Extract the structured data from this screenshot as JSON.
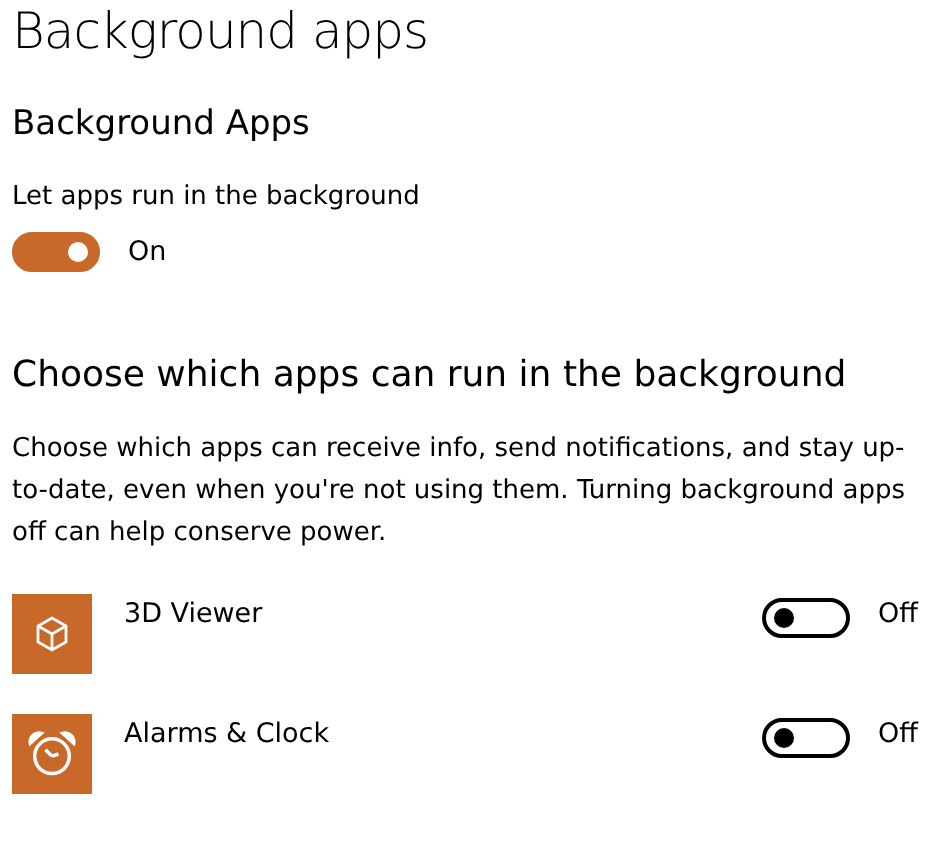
{
  "title": "Background apps",
  "section": {
    "heading": "Background Apps",
    "label": "Let apps run in the background",
    "toggle": {
      "on": true,
      "state_label": "On"
    }
  },
  "apps_section": {
    "heading": "Choose which apps can run in the background",
    "description": "Choose which apps can receive info, send notifications, and stay up-to-date, even when you're not using them. Turning background apps off can help conserve power.",
    "apps": [
      {
        "name": "3D Viewer",
        "on": false,
        "state_label": "Off"
      },
      {
        "name": "Alarms & Clock",
        "on": false,
        "state_label": "Off"
      }
    ]
  }
}
